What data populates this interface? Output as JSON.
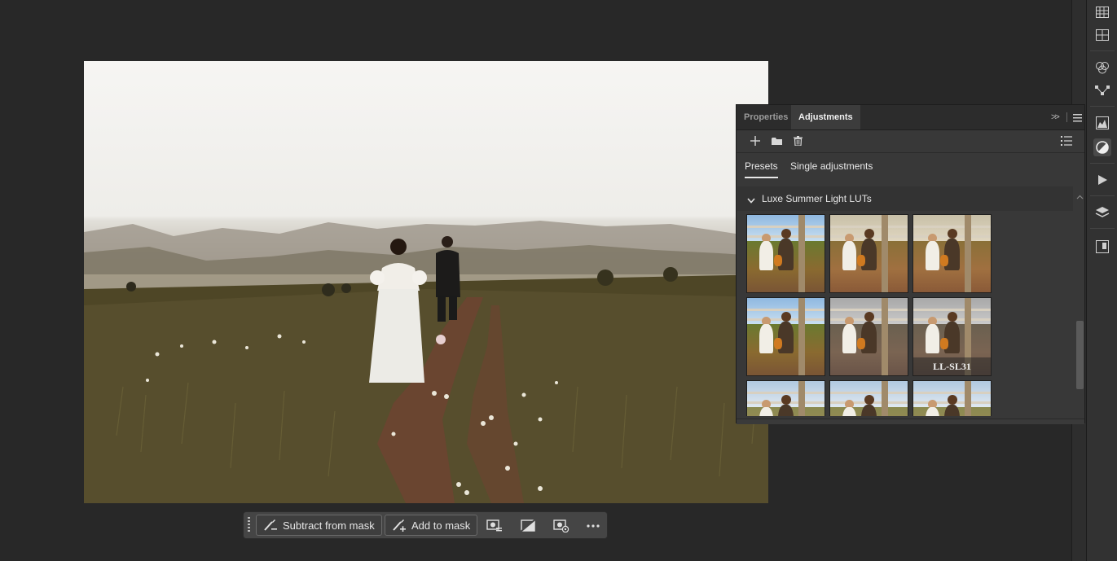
{
  "panel": {
    "tabs": [
      {
        "label": "Properties",
        "active": false
      },
      {
        "label": "Adjustments",
        "active": true
      }
    ],
    "subtabs": [
      {
        "label": "Presets",
        "active": true
      },
      {
        "label": "Single adjustments",
        "active": false
      }
    ],
    "group": {
      "title": "Luxe Summer Light LUTs",
      "expanded": true,
      "thumbnails": [
        {
          "label": "",
          "tone": "normal"
        },
        {
          "label": "",
          "tone": "warm"
        },
        {
          "label": "",
          "tone": "warm"
        },
        {
          "label": "",
          "tone": "normal"
        },
        {
          "label": "",
          "tone": "fade"
        },
        {
          "label": "LL-SL31",
          "tone": "fade"
        },
        {
          "label": "",
          "tone": "pale"
        },
        {
          "label": "",
          "tone": "pale"
        },
        {
          "label": "",
          "tone": "pale"
        }
      ]
    },
    "toolbar_icons": [
      "add-icon",
      "folder-icon",
      "trash-icon",
      "list-view-icon"
    ]
  },
  "taskbar": {
    "subtract_label": "Subtract from mask",
    "add_label": "Add to mask",
    "icons": [
      "mask-settings-icon",
      "invert-mask-icon",
      "mask-view-icon",
      "more-icon"
    ]
  },
  "right_rail": {
    "icons": [
      "table-icon",
      "grid-icon",
      "channels-icon",
      "paths-icon",
      "histogram-icon",
      "adjustments-icon",
      "play-icon",
      "layers-icon",
      "library-icon"
    ],
    "active": "adjustments-icon"
  },
  "colors": {
    "app_background": "#282828",
    "panel_background": "#383838",
    "accent_text": "#f0f0f0"
  }
}
